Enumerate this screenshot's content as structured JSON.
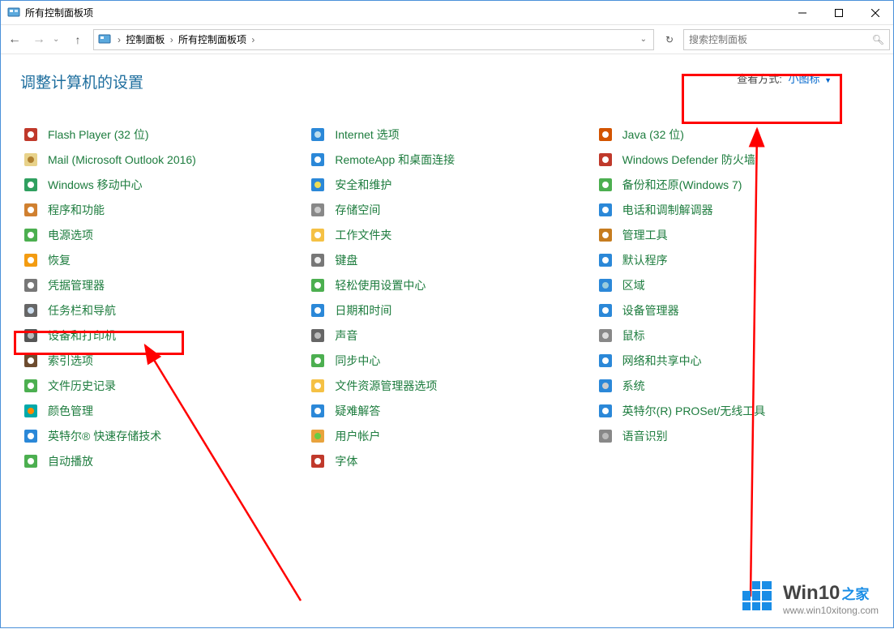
{
  "window_title": "所有控制面板项",
  "breadcrumb": {
    "root_label": "控制面板",
    "current_label": "所有控制面板项"
  },
  "search_placeholder": "搜索控制面板",
  "page_title": "调整计算机的设置",
  "view_label": "查看方式:",
  "view_value": "小图标",
  "columns": [
    {
      "items": [
        {
          "icon": "flash",
          "label": "Flash Player (32 位)",
          "key": "flash-player"
        },
        {
          "icon": "mail",
          "label": "Mail (Microsoft Outlook 2016)",
          "key": "mail"
        },
        {
          "icon": "mobility",
          "label": "Windows 移动中心",
          "key": "mobility-center"
        },
        {
          "icon": "programs",
          "label": "程序和功能",
          "key": "programs-features"
        },
        {
          "icon": "power",
          "label": "电源选项",
          "key": "power-options"
        },
        {
          "icon": "recovery",
          "label": "恢复",
          "key": "recovery"
        },
        {
          "icon": "credential",
          "label": "凭据管理器",
          "key": "credential-manager"
        },
        {
          "icon": "taskbar",
          "label": "任务栏和导航",
          "key": "taskbar-navigation"
        },
        {
          "icon": "devices",
          "label": "设备和打印机",
          "key": "devices-printers"
        },
        {
          "icon": "indexing",
          "label": "索引选项",
          "key": "indexing-options"
        },
        {
          "icon": "filehistory",
          "label": "文件历史记录",
          "key": "file-history"
        },
        {
          "icon": "color",
          "label": "颜色管理",
          "key": "color-management"
        },
        {
          "icon": "intel-rst",
          "label": "英特尔® 快速存储技术",
          "key": "intel-rst"
        },
        {
          "icon": "autoplay",
          "label": "自动播放",
          "key": "autoplay"
        }
      ]
    },
    {
      "items": [
        {
          "icon": "internet",
          "label": "Internet 选项",
          "key": "internet-options"
        },
        {
          "icon": "remoteapp",
          "label": "RemoteApp 和桌面连接",
          "key": "remoteapp"
        },
        {
          "icon": "security",
          "label": "安全和维护",
          "key": "security-maintenance"
        },
        {
          "icon": "storage",
          "label": "存储空间",
          "key": "storage-spaces"
        },
        {
          "icon": "workfolders",
          "label": "工作文件夹",
          "key": "work-folders"
        },
        {
          "icon": "keyboard",
          "label": "键盘",
          "key": "keyboard"
        },
        {
          "icon": "ease",
          "label": "轻松使用设置中心",
          "key": "ease-of-access"
        },
        {
          "icon": "datetime",
          "label": "日期和时间",
          "key": "date-time"
        },
        {
          "icon": "sound",
          "label": "声音",
          "key": "sound"
        },
        {
          "icon": "sync",
          "label": "同步中心",
          "key": "sync-center"
        },
        {
          "icon": "explorer",
          "label": "文件资源管理器选项",
          "key": "explorer-options"
        },
        {
          "icon": "troubleshoot",
          "label": "疑难解答",
          "key": "troubleshooting"
        },
        {
          "icon": "user",
          "label": "用户帐户",
          "key": "user-accounts"
        },
        {
          "icon": "fonts",
          "label": "字体",
          "key": "fonts"
        }
      ]
    },
    {
      "items": [
        {
          "icon": "java",
          "label": "Java (32 位)",
          "key": "java"
        },
        {
          "icon": "defender",
          "label": "Windows Defender 防火墙",
          "key": "defender-firewall"
        },
        {
          "icon": "backup",
          "label": "备份和还原(Windows 7)",
          "key": "backup-restore"
        },
        {
          "icon": "phone",
          "label": "电话和调制解调器",
          "key": "phone-modem"
        },
        {
          "icon": "admin",
          "label": "管理工具",
          "key": "admin-tools"
        },
        {
          "icon": "defaults",
          "label": "默认程序",
          "key": "default-programs"
        },
        {
          "icon": "region",
          "label": "区域",
          "key": "region"
        },
        {
          "icon": "devmgr",
          "label": "设备管理器",
          "key": "device-manager"
        },
        {
          "icon": "mouse",
          "label": "鼠标",
          "key": "mouse"
        },
        {
          "icon": "network",
          "label": "网络和共享中心",
          "key": "network-sharing"
        },
        {
          "icon": "system",
          "label": "系统",
          "key": "system"
        },
        {
          "icon": "intel-wifi",
          "label": "英特尔(R) PROSet/无线工具",
          "key": "intel-proset"
        },
        {
          "icon": "speech",
          "label": "语音识别",
          "key": "speech-recognition"
        }
      ]
    }
  ],
  "watermark": {
    "brand_main": "Win10",
    "brand_suffix": "之家",
    "url": "www.win10xitong.com"
  }
}
